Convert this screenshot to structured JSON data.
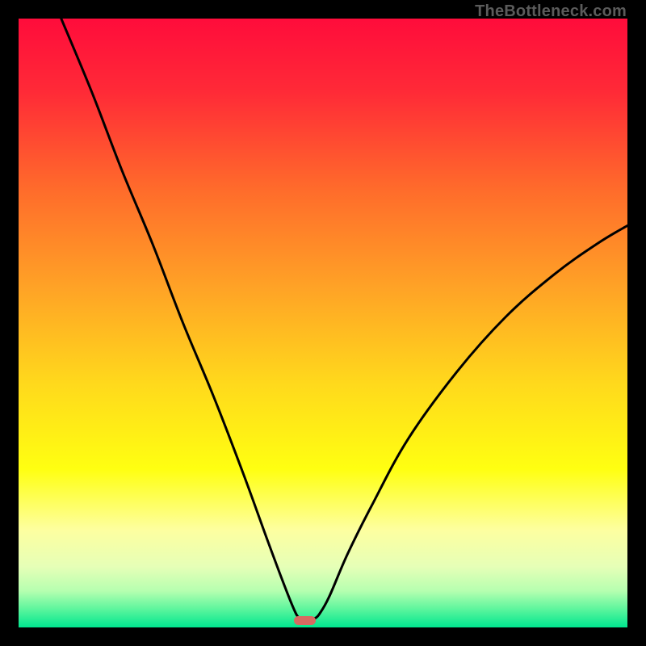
{
  "watermark": "TheBottleneck.com",
  "colors": {
    "gradient_stops": [
      {
        "offset": 0.0,
        "color": "#ff0c3b"
      },
      {
        "offset": 0.12,
        "color": "#ff2a37"
      },
      {
        "offset": 0.28,
        "color": "#ff6b2b"
      },
      {
        "offset": 0.44,
        "color": "#ffa226"
      },
      {
        "offset": 0.6,
        "color": "#ffd91c"
      },
      {
        "offset": 0.74,
        "color": "#ffff11"
      },
      {
        "offset": 0.84,
        "color": "#fdffa0"
      },
      {
        "offset": 0.9,
        "color": "#e6ffb7"
      },
      {
        "offset": 0.94,
        "color": "#b6ffb0"
      },
      {
        "offset": 0.97,
        "color": "#5cf59d"
      },
      {
        "offset": 1.0,
        "color": "#00e68f"
      }
    ],
    "curve": "#000000",
    "marker": "#d76a61",
    "frame_bg": "#000000"
  },
  "chart_data": {
    "type": "line",
    "title": "",
    "xlabel": "",
    "ylabel": "",
    "xlim": [
      0,
      100
    ],
    "ylim": [
      0,
      100
    ],
    "optimum_x": 47,
    "optimum_width_pct": 3.5,
    "left_curve": [
      {
        "x": 7,
        "y": 100
      },
      {
        "x": 12,
        "y": 88
      },
      {
        "x": 17,
        "y": 75
      },
      {
        "x": 22,
        "y": 63
      },
      {
        "x": 27,
        "y": 50
      },
      {
        "x": 32,
        "y": 38
      },
      {
        "x": 37,
        "y": 25
      },
      {
        "x": 41,
        "y": 14
      },
      {
        "x": 44,
        "y": 6
      },
      {
        "x": 45.6,
        "y": 2.2
      },
      {
        "x": 46.3,
        "y": 1.5
      }
    ],
    "right_curve": [
      {
        "x": 48.7,
        "y": 1.5
      },
      {
        "x": 49.4,
        "y": 2.2
      },
      {
        "x": 51,
        "y": 5
      },
      {
        "x": 54,
        "y": 12
      },
      {
        "x": 58,
        "y": 20
      },
      {
        "x": 64,
        "y": 31
      },
      {
        "x": 72,
        "y": 42
      },
      {
        "x": 80,
        "y": 51
      },
      {
        "x": 88,
        "y": 58
      },
      {
        "x": 95,
        "y": 63
      },
      {
        "x": 100,
        "y": 66
      }
    ]
  }
}
